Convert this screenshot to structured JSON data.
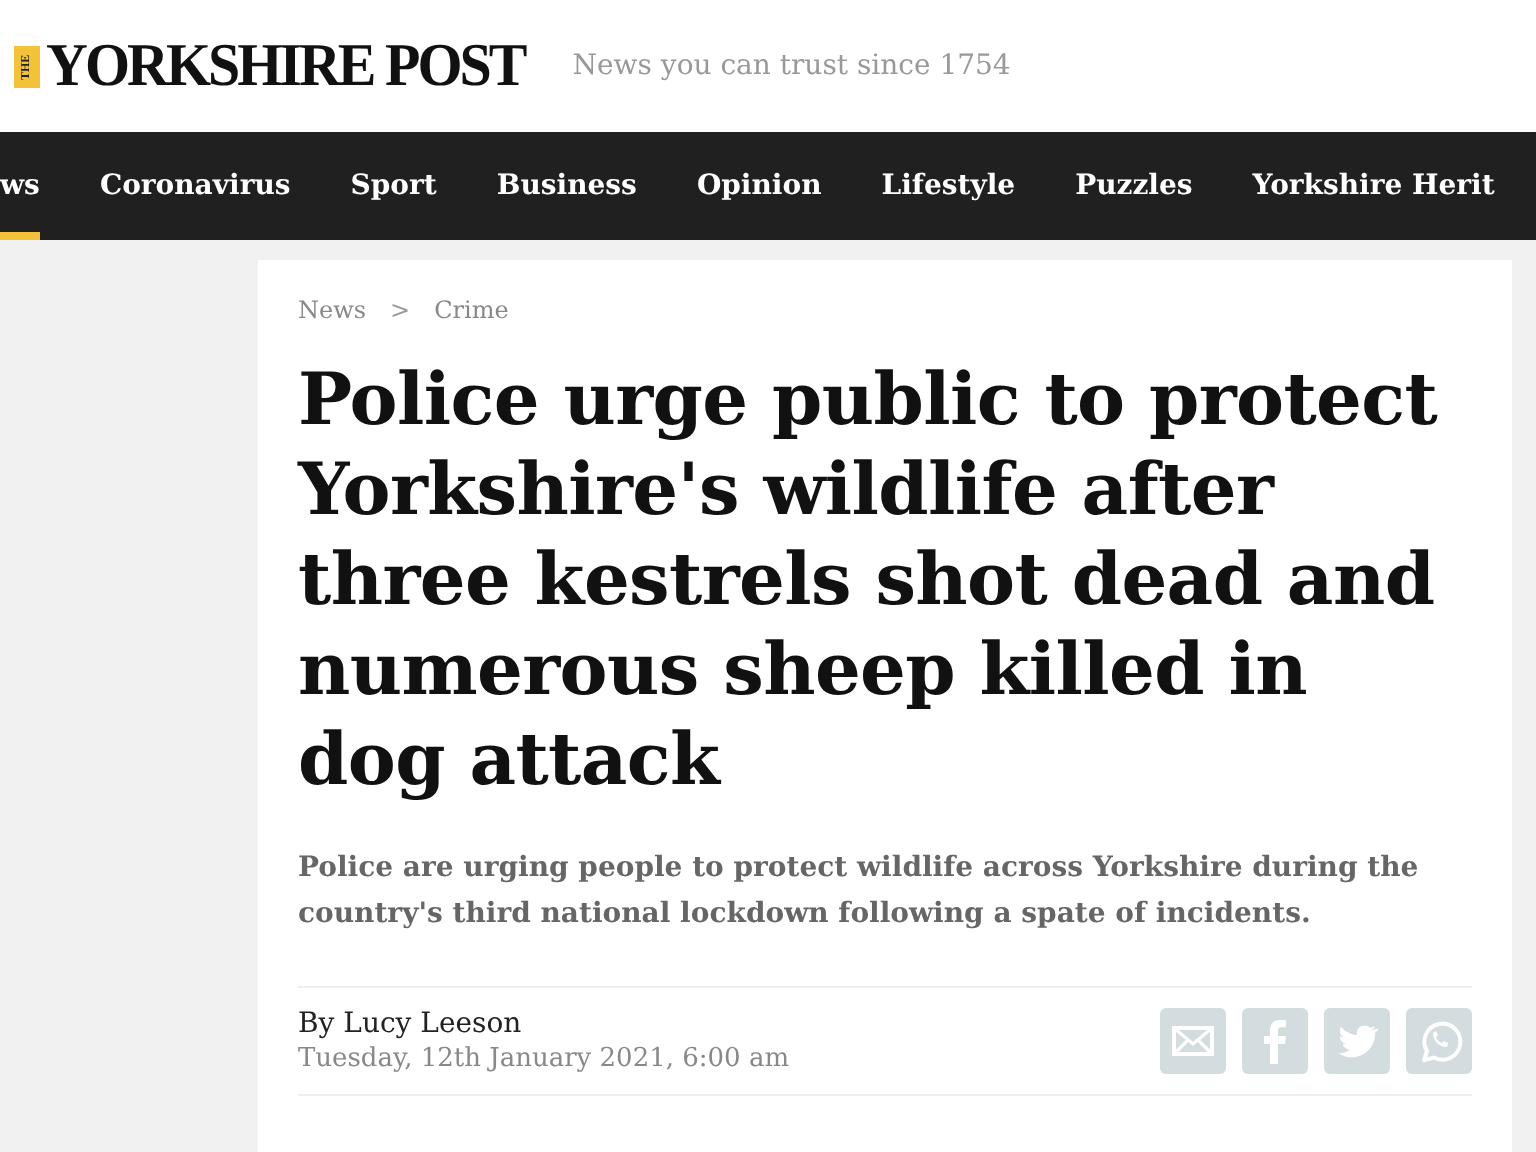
{
  "logo": {
    "small": "THE",
    "main": "YORKSHIRE POST"
  },
  "tagline": "News you can trust since 1754",
  "nav": [
    {
      "label": "ws",
      "selected": true
    },
    {
      "label": "Coronavirus",
      "selected": false
    },
    {
      "label": "Sport",
      "selected": false
    },
    {
      "label": "Business",
      "selected": false
    },
    {
      "label": "Opinion",
      "selected": false
    },
    {
      "label": "Lifestyle",
      "selected": false
    },
    {
      "label": "Puzzles",
      "selected": false
    },
    {
      "label": "Yorkshire Herit",
      "selected": false
    }
  ],
  "breadcrumb": [
    "News",
    "Crime"
  ],
  "breadcrumb_separator": ">",
  "headline": "Police urge public to protect Yorkshire's wildlife after three kestrels shot dead and numerous sheep killed in dog attack",
  "standfirst": "Police are urging people to protect wildlife across Yorkshire during the country's third national lockdown following a spate of incidents.",
  "byline": "By Lucy Leeson",
  "date": "Tuesday, 12th January 2021, 6:00 am",
  "share": [
    {
      "kind": "email"
    },
    {
      "kind": "facebook"
    },
    {
      "kind": "twitter"
    },
    {
      "kind": "whatsapp"
    }
  ]
}
